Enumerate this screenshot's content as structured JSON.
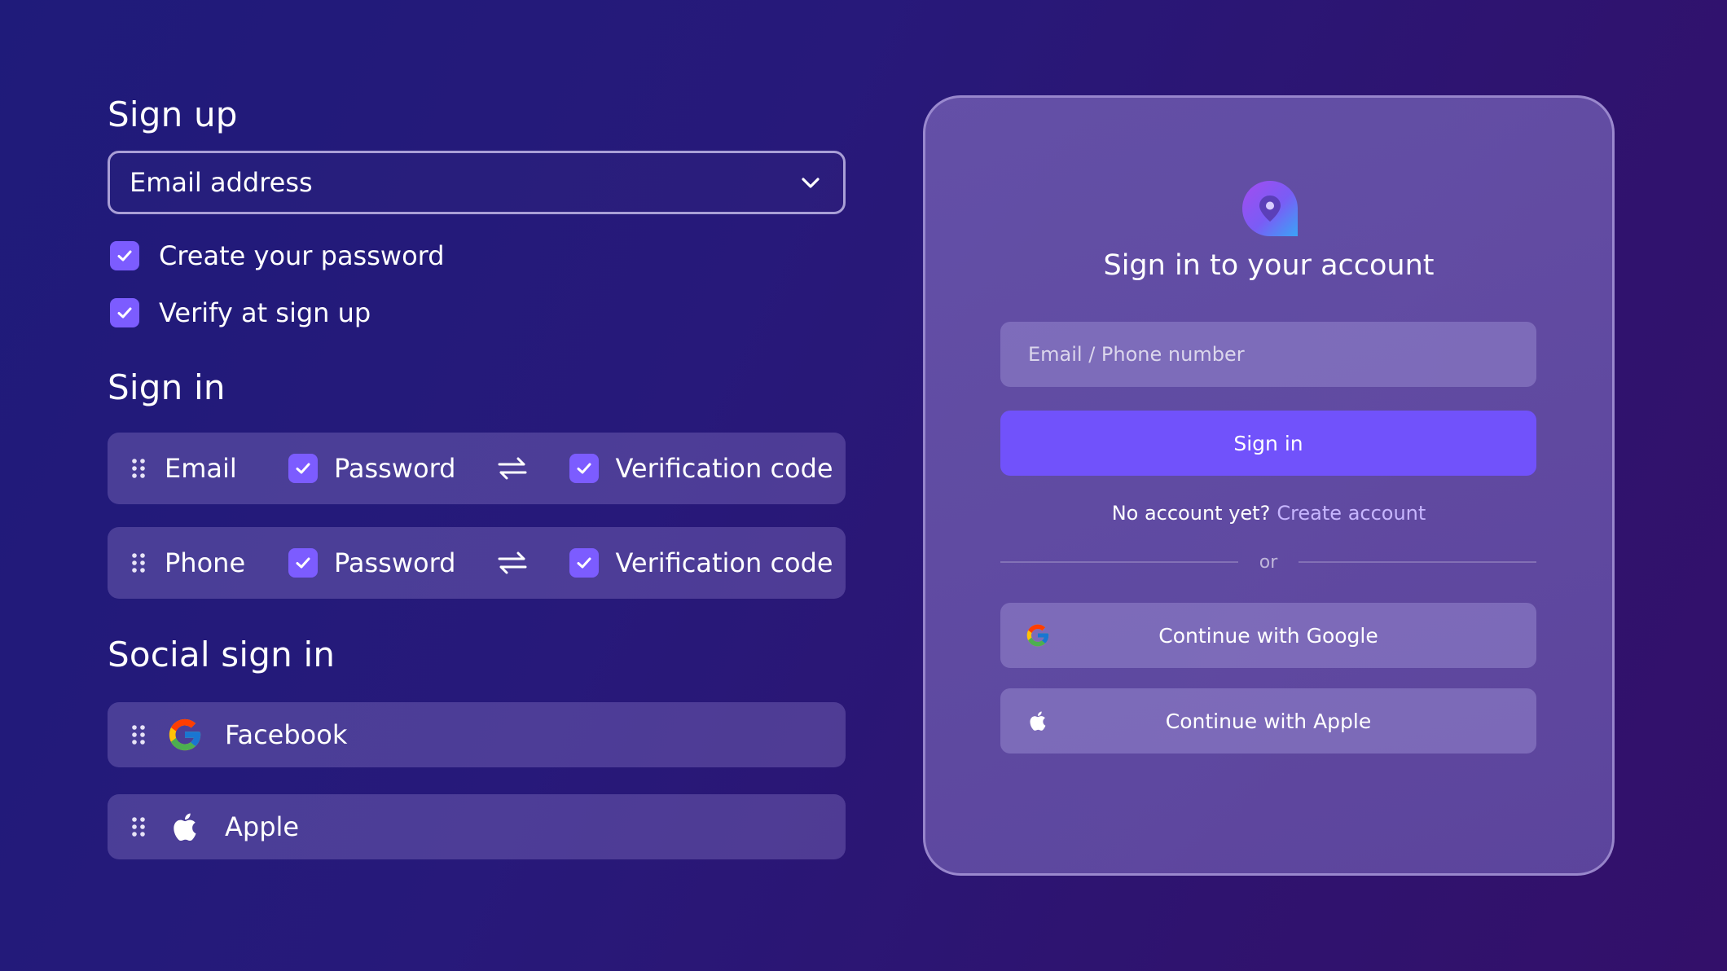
{
  "signup": {
    "title": "Sign up",
    "identifier_select": {
      "value": "Email address"
    },
    "options": [
      {
        "label": "Create your password",
        "checked": true
      },
      {
        "label": "Verify at sign up",
        "checked": true
      }
    ]
  },
  "signin": {
    "title": "Sign in",
    "methods": [
      {
        "name": "Email",
        "option1": "Password",
        "option2": "Verification code"
      },
      {
        "name": "Phone",
        "option1": "Password",
        "option2": "Verification code"
      }
    ]
  },
  "social": {
    "title": "Social sign in",
    "items": [
      {
        "label": "Facebook",
        "icon": "google-icon"
      },
      {
        "label": "Apple",
        "icon": "apple-icon"
      }
    ]
  },
  "card": {
    "title": "Sign in to your account",
    "input_placeholder": "Email / Phone number",
    "signin_button": "Sign in",
    "no_account_text": "No account yet?",
    "create_account_link": "Create account",
    "divider_text": "or",
    "google_button": "Continue with Google",
    "apple_button": "Continue with Apple"
  },
  "colors": {
    "accent": "#7152fb",
    "checkbox": "#7c5cff",
    "link": "#c7b6ff"
  }
}
